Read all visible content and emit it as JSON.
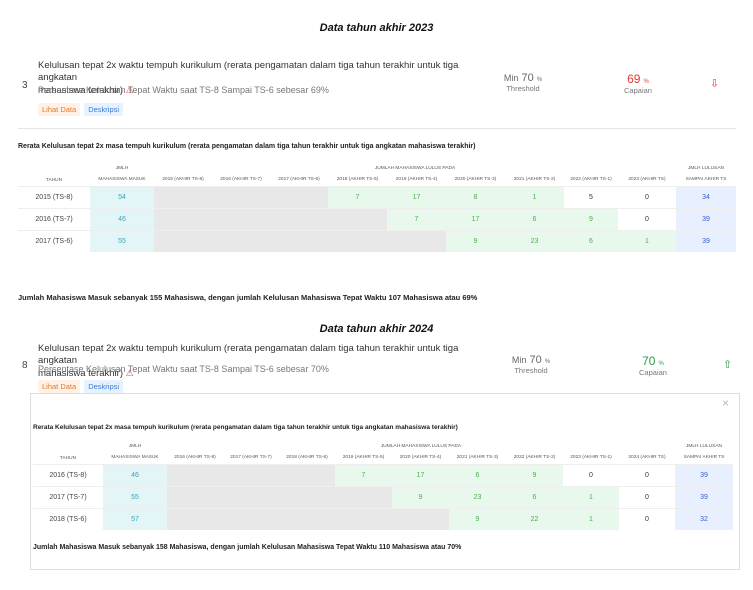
{
  "section2023": {
    "heading": "Data tahun akhir 2023",
    "index": "3",
    "title_line1": "Kelulusan tepat 2x waktu tempuh kurikulum (rerata pengamatan dalam tiga tahun terakhir untuk tiga angkatan",
    "title_line2": "mahasiswa terakhir)",
    "subtitle": "Persentase Kelulusan Tepat Waktu saat TS-8 Sampai TS-6 sebesar 69%",
    "badge_view": "Lihat Data",
    "badge_desc": "Deskripsi",
    "threshold_prefix": "Min",
    "threshold_value": "70",
    "threshold_unit": "%",
    "threshold_label": "Threshold",
    "capaian_value": "69",
    "capaian_unit": "%",
    "capaian_label": "Capaian",
    "status_color": "#e53935",
    "table_title": "Rerata Kelulusan tepat 2x masa tempuh kurikulum (rerata pengamatan dalam tiga tahun terakhir untuk tiga angkatan mahasiswa terakhir)",
    "group_header": "JUMLAH MAHASISWA LULUS PADA",
    "col_tahun": "TAHUN",
    "col_masuk_1": "JMLH",
    "col_masuk_2": "MAHASISWA MASUK",
    "col_lulusan_1": "JMLH LULUSAN",
    "col_lulusan_2": "SAMPAI AKHIR TS",
    "cols": [
      "2015 (AKHIR TS-8)",
      "2016 (AKHIR TS-7)",
      "2017 (AKHIR TS-6)",
      "2018 (AKHIR TS-5)",
      "2019 (AKHIR TS-4)",
      "2020 (AKHIR TS-3)",
      "2021 (AKHIR TS-2)",
      "2022 (AKHIR TS-1)",
      "2023 (AKHIR TS)"
    ],
    "rows": [
      {
        "tahun": "2015 (TS-8)",
        "masuk": "54",
        "cells": [
          "",
          "",
          "",
          "7",
          "17",
          "8",
          "1",
          "5",
          "0"
        ],
        "lulusan": "34"
      },
      {
        "tahun": "2016 (TS-7)",
        "masuk": "46",
        "cells": [
          "",
          "",
          "",
          "",
          "7",
          "17",
          "6",
          "9",
          "0"
        ],
        "lulusan": "39"
      },
      {
        "tahun": "2017 (TS-6)",
        "masuk": "55",
        "cells": [
          "",
          "",
          "",
          "",
          "",
          "9",
          "23",
          "6",
          "1"
        ],
        "lulusan": "39"
      }
    ],
    "footer": "Jumlah Mahasiswa Masuk sebanyak 155 Mahasiswa, dengan jumlah Kelulusan Mahasiswa Tepat Waktu 107 Mahasiswa atau 69%"
  },
  "section2024": {
    "heading": "Data tahun akhir 2024",
    "index": "8",
    "title_line1": "Kelulusan tepat 2x waktu tempuh kurikulum (rerata pengamatan dalam tiga tahun terakhir untuk tiga angkatan",
    "title_line2": "mahasiswa terakhir)",
    "subtitle": "Persentase Kelulusan Tepat Waktu saat TS-8 Sampai TS-6 sebesar 70%",
    "badge_view": "Lihat Data",
    "badge_desc": "Deskripsi",
    "threshold_prefix": "Min",
    "threshold_value": "70",
    "threshold_unit": "%",
    "threshold_label": "Threshold",
    "capaian_value": "70",
    "capaian_unit": "%",
    "capaian_label": "Capaian",
    "status_color": "#2e9b47",
    "close_glyph": "×",
    "table_title": "Rerata Kelulusan tepat 2x masa tempuh kurikulum (rerata pengamatan dalam tiga tahun terakhir untuk tiga angkatan mahasiswa terakhir)",
    "group_header": "JUMLAH MAHASISWA LULUS PADA",
    "col_tahun": "TAHUN",
    "col_masuk_1": "JMLH",
    "col_masuk_2": "MAHASISWA MASUK",
    "col_lulusan_1": "JMLH LULUSAN",
    "col_lulusan_2": "SAMPAI AKHIR TS",
    "cols": [
      "2016 (AKHIR TS-8)",
      "2017 (AKHIR TS-7)",
      "2018 (AKHIR TS-6)",
      "2019 (AKHIR TS-5)",
      "2020 (AKHIR TS-4)",
      "2021 (AKHIR TS-3)",
      "2022 (AKHIR TS-2)",
      "2023 (AKHIR TS-1)",
      "2024 (AKHIR TS)"
    ],
    "rows": [
      {
        "tahun": "2016 (TS-8)",
        "masuk": "46",
        "cells": [
          "",
          "",
          "",
          "7",
          "17",
          "6",
          "9",
          "0",
          "0"
        ],
        "lulusan": "39"
      },
      {
        "tahun": "2017 (TS-7)",
        "masuk": "55",
        "cells": [
          "",
          "",
          "",
          "",
          "9",
          "23",
          "6",
          "1",
          "0"
        ],
        "lulusan": "39"
      },
      {
        "tahun": "2018 (TS-6)",
        "masuk": "57",
        "cells": [
          "",
          "",
          "",
          "",
          "",
          "9",
          "22",
          "1",
          "0"
        ],
        "lulusan": "32"
      }
    ],
    "footer": "Jumlah Mahasiswa Masuk sebanyak 158 Mahasiswa, dengan jumlah Kelulusan Mahasiswa Tepat Waktu 110 Mahasiswa atau 70%"
  }
}
